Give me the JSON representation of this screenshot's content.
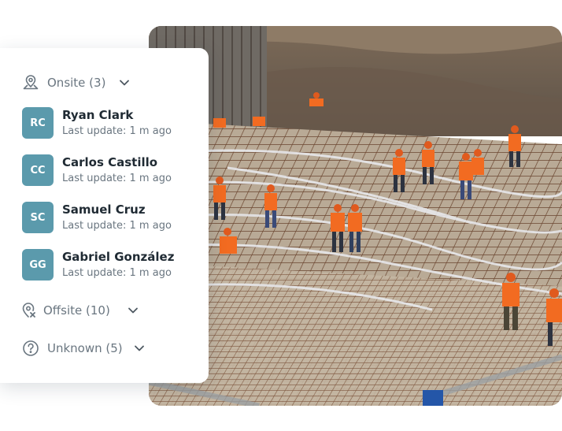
{
  "groups": {
    "onsite": {
      "label": "Onsite (3)",
      "icon": "map-pin-icon"
    },
    "offsite": {
      "label": "Offsite (10)",
      "icon": "location-off-icon"
    },
    "unknown": {
      "label": "Unknown (5)",
      "icon": "question-circle-icon"
    }
  },
  "people": [
    {
      "initials": "RC",
      "name": "Ryan Clark",
      "update": "Last update: 1 m ago"
    },
    {
      "initials": "CC",
      "name": "Carlos Castillo",
      "update": "Last update: 1 m ago"
    },
    {
      "initials": "SC",
      "name": "Samuel Cruz",
      "update": "Last update: 1 m ago"
    },
    {
      "initials": "GG",
      "name": "Gabriel González",
      "update": "Last update: 1 m ago"
    }
  ],
  "colors": {
    "avatar": "#5b9aac",
    "muted_text": "#6a7680",
    "name_text": "#1f2a33",
    "worker_vest": "#f26b21"
  }
}
